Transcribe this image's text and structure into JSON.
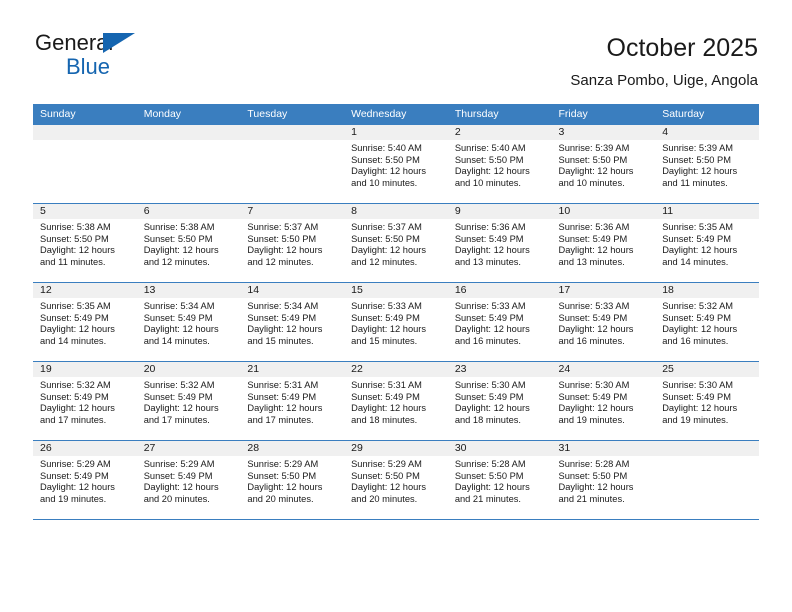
{
  "brand": {
    "name_part1": "General",
    "name_part2": "Blue",
    "triangle_icon": "triangle-icon",
    "accent_color": "#1565b0"
  },
  "header": {
    "title": "October 2025",
    "subtitle": "Sanza Pombo, Uige, Angola"
  },
  "theme": {
    "header_row_bg": "#3a7ebf",
    "daynum_band_bg": "#f0f0f0",
    "grid_line": "#3a7ebf",
    "text": "#1a1a1a"
  },
  "weekday_headers": [
    "Sunday",
    "Monday",
    "Tuesday",
    "Wednesday",
    "Thursday",
    "Friday",
    "Saturday"
  ],
  "labels": {
    "sunrise_prefix": "Sunrise:",
    "sunset_prefix": "Sunset:",
    "daylight_prefix": "Daylight:"
  },
  "weeks": [
    [
      {
        "day": "",
        "line1": "",
        "line2": "",
        "line3": "",
        "line4": "",
        "empty": true
      },
      {
        "day": "",
        "line1": "",
        "line2": "",
        "line3": "",
        "line4": "",
        "empty": true
      },
      {
        "day": "",
        "line1": "",
        "line2": "",
        "line3": "",
        "line4": "",
        "empty": true
      },
      {
        "day": "1",
        "line1": "Sunrise: 5:40 AM",
        "line2": "Sunset: 5:50 PM",
        "line3": "Daylight: 12 hours",
        "line4": "and 10 minutes.",
        "empty": false
      },
      {
        "day": "2",
        "line1": "Sunrise: 5:40 AM",
        "line2": "Sunset: 5:50 PM",
        "line3": "Daylight: 12 hours",
        "line4": "and 10 minutes.",
        "empty": false
      },
      {
        "day": "3",
        "line1": "Sunrise: 5:39 AM",
        "line2": "Sunset: 5:50 PM",
        "line3": "Daylight: 12 hours",
        "line4": "and 10 minutes.",
        "empty": false
      },
      {
        "day": "4",
        "line1": "Sunrise: 5:39 AM",
        "line2": "Sunset: 5:50 PM",
        "line3": "Daylight: 12 hours",
        "line4": "and 11 minutes.",
        "empty": false
      }
    ],
    [
      {
        "day": "5",
        "line1": "Sunrise: 5:38 AM",
        "line2": "Sunset: 5:50 PM",
        "line3": "Daylight: 12 hours",
        "line4": "and 11 minutes.",
        "empty": false
      },
      {
        "day": "6",
        "line1": "Sunrise: 5:38 AM",
        "line2": "Sunset: 5:50 PM",
        "line3": "Daylight: 12 hours",
        "line4": "and 12 minutes.",
        "empty": false
      },
      {
        "day": "7",
        "line1": "Sunrise: 5:37 AM",
        "line2": "Sunset: 5:50 PM",
        "line3": "Daylight: 12 hours",
        "line4": "and 12 minutes.",
        "empty": false
      },
      {
        "day": "8",
        "line1": "Sunrise: 5:37 AM",
        "line2": "Sunset: 5:50 PM",
        "line3": "Daylight: 12 hours",
        "line4": "and 12 minutes.",
        "empty": false
      },
      {
        "day": "9",
        "line1": "Sunrise: 5:36 AM",
        "line2": "Sunset: 5:49 PM",
        "line3": "Daylight: 12 hours",
        "line4": "and 13 minutes.",
        "empty": false
      },
      {
        "day": "10",
        "line1": "Sunrise: 5:36 AM",
        "line2": "Sunset: 5:49 PM",
        "line3": "Daylight: 12 hours",
        "line4": "and 13 minutes.",
        "empty": false
      },
      {
        "day": "11",
        "line1": "Sunrise: 5:35 AM",
        "line2": "Sunset: 5:49 PM",
        "line3": "Daylight: 12 hours",
        "line4": "and 14 minutes.",
        "empty": false
      }
    ],
    [
      {
        "day": "12",
        "line1": "Sunrise: 5:35 AM",
        "line2": "Sunset: 5:49 PM",
        "line3": "Daylight: 12 hours",
        "line4": "and 14 minutes.",
        "empty": false
      },
      {
        "day": "13",
        "line1": "Sunrise: 5:34 AM",
        "line2": "Sunset: 5:49 PM",
        "line3": "Daylight: 12 hours",
        "line4": "and 14 minutes.",
        "empty": false
      },
      {
        "day": "14",
        "line1": "Sunrise: 5:34 AM",
        "line2": "Sunset: 5:49 PM",
        "line3": "Daylight: 12 hours",
        "line4": "and 15 minutes.",
        "empty": false
      },
      {
        "day": "15",
        "line1": "Sunrise: 5:33 AM",
        "line2": "Sunset: 5:49 PM",
        "line3": "Daylight: 12 hours",
        "line4": "and 15 minutes.",
        "empty": false
      },
      {
        "day": "16",
        "line1": "Sunrise: 5:33 AM",
        "line2": "Sunset: 5:49 PM",
        "line3": "Daylight: 12 hours",
        "line4": "and 16 minutes.",
        "empty": false
      },
      {
        "day": "17",
        "line1": "Sunrise: 5:33 AM",
        "line2": "Sunset: 5:49 PM",
        "line3": "Daylight: 12 hours",
        "line4": "and 16 minutes.",
        "empty": false
      },
      {
        "day": "18",
        "line1": "Sunrise: 5:32 AM",
        "line2": "Sunset: 5:49 PM",
        "line3": "Daylight: 12 hours",
        "line4": "and 16 minutes.",
        "empty": false
      }
    ],
    [
      {
        "day": "19",
        "line1": "Sunrise: 5:32 AM",
        "line2": "Sunset: 5:49 PM",
        "line3": "Daylight: 12 hours",
        "line4": "and 17 minutes.",
        "empty": false
      },
      {
        "day": "20",
        "line1": "Sunrise: 5:32 AM",
        "line2": "Sunset: 5:49 PM",
        "line3": "Daylight: 12 hours",
        "line4": "and 17 minutes.",
        "empty": false
      },
      {
        "day": "21",
        "line1": "Sunrise: 5:31 AM",
        "line2": "Sunset: 5:49 PM",
        "line3": "Daylight: 12 hours",
        "line4": "and 17 minutes.",
        "empty": false
      },
      {
        "day": "22",
        "line1": "Sunrise: 5:31 AM",
        "line2": "Sunset: 5:49 PM",
        "line3": "Daylight: 12 hours",
        "line4": "and 18 minutes.",
        "empty": false
      },
      {
        "day": "23",
        "line1": "Sunrise: 5:30 AM",
        "line2": "Sunset: 5:49 PM",
        "line3": "Daylight: 12 hours",
        "line4": "and 18 minutes.",
        "empty": false
      },
      {
        "day": "24",
        "line1": "Sunrise: 5:30 AM",
        "line2": "Sunset: 5:49 PM",
        "line3": "Daylight: 12 hours",
        "line4": "and 19 minutes.",
        "empty": false
      },
      {
        "day": "25",
        "line1": "Sunrise: 5:30 AM",
        "line2": "Sunset: 5:49 PM",
        "line3": "Daylight: 12 hours",
        "line4": "and 19 minutes.",
        "empty": false
      }
    ],
    [
      {
        "day": "26",
        "line1": "Sunrise: 5:29 AM",
        "line2": "Sunset: 5:49 PM",
        "line3": "Daylight: 12 hours",
        "line4": "and 19 minutes.",
        "empty": false
      },
      {
        "day": "27",
        "line1": "Sunrise: 5:29 AM",
        "line2": "Sunset: 5:49 PM",
        "line3": "Daylight: 12 hours",
        "line4": "and 20 minutes.",
        "empty": false
      },
      {
        "day": "28",
        "line1": "Sunrise: 5:29 AM",
        "line2": "Sunset: 5:50 PM",
        "line3": "Daylight: 12 hours",
        "line4": "and 20 minutes.",
        "empty": false
      },
      {
        "day": "29",
        "line1": "Sunrise: 5:29 AM",
        "line2": "Sunset: 5:50 PM",
        "line3": "Daylight: 12 hours",
        "line4": "and 20 minutes.",
        "empty": false
      },
      {
        "day": "30",
        "line1": "Sunrise: 5:28 AM",
        "line2": "Sunset: 5:50 PM",
        "line3": "Daylight: 12 hours",
        "line4": "and 21 minutes.",
        "empty": false
      },
      {
        "day": "31",
        "line1": "Sunrise: 5:28 AM",
        "line2": "Sunset: 5:50 PM",
        "line3": "Daylight: 12 hours",
        "line4": "and 21 minutes.",
        "empty": false
      },
      {
        "day": "",
        "line1": "",
        "line2": "",
        "line3": "",
        "line4": "",
        "empty": true
      }
    ]
  ]
}
